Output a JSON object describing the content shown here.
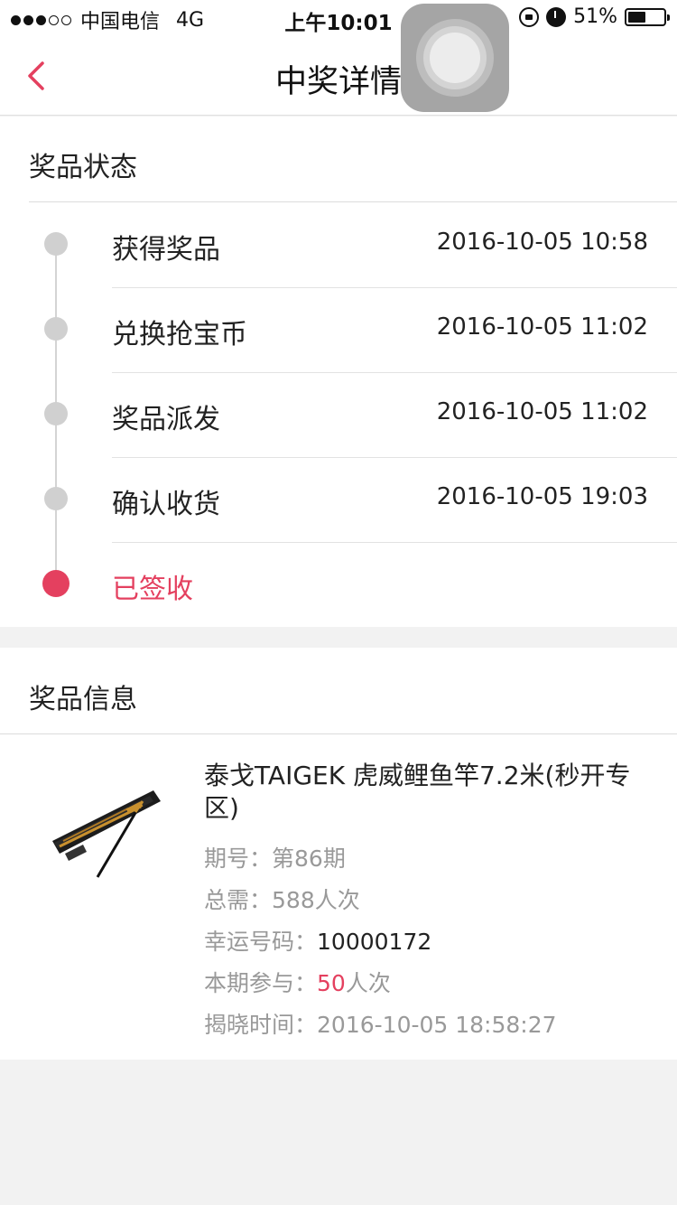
{
  "status_bar": {
    "carrier": "中国电信",
    "network": "4G",
    "time": "上午10:01",
    "battery": "51%",
    "battery_level": 0.51,
    "signal_filled": 3,
    "signal_total": 5
  },
  "nav": {
    "title": "中奖详情"
  },
  "status_section": {
    "title": "奖品状态",
    "steps": [
      {
        "label": "获得奖品",
        "time": "2016-10-05 10:58"
      },
      {
        "label": "兑换抢宝币",
        "time": "2016-10-05 11:02"
      },
      {
        "label": "奖品派发",
        "time": "2016-10-05 11:02"
      },
      {
        "label": "确认收货",
        "time": "2016-10-05 19:03"
      },
      {
        "label": "已签收",
        "time": ""
      }
    ],
    "active_index": 4
  },
  "info_section": {
    "title": "奖品信息",
    "product_name": "泰戈TAIGEK 虎威鲤鱼竿7.2米(秒开专区)",
    "period_label": "期号：",
    "period_value": "第86期",
    "total_label": "总需：",
    "total_value": "588人次",
    "lucky_label": "幸运号码：",
    "lucky_value": "10000172",
    "join_label": "本期参与：",
    "join_count": "50",
    "join_unit": "人次",
    "reveal_label": "揭晓时间：",
    "reveal_value": "2016-10-05 18:58:27"
  },
  "colors": {
    "accent": "#e4405f",
    "muted": "#999999",
    "timeline": "#d0d0d0",
    "background": "#f2f2f2"
  }
}
